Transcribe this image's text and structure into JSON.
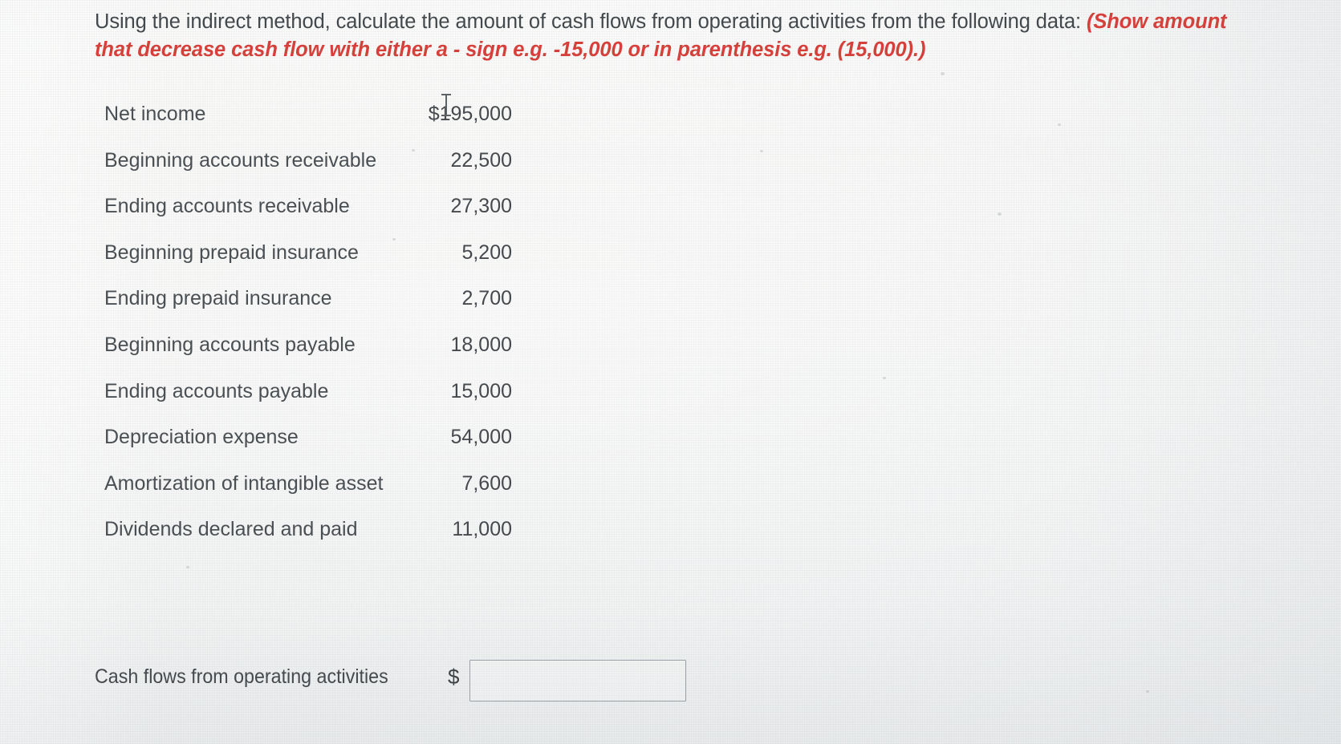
{
  "prompt": {
    "text_plain": "Using the indirect method, calculate the amount of cash flows from operating activities from the following data: ",
    "text_hint": "(Show amount that decrease cash flow with either a - sign e.g. -15,000 or in parenthesis e.g. (15,000).)",
    "hint_color": "#d6403a",
    "body_color": "#42484c"
  },
  "table": {
    "rows": [
      {
        "label": "Net income",
        "value": "$195,000"
      },
      {
        "label": "Beginning accounts receivable",
        "value": "22,500"
      },
      {
        "label": "Ending accounts receivable",
        "value": "27,300"
      },
      {
        "label": "Beginning prepaid insurance",
        "value": "5,200"
      },
      {
        "label": "Ending prepaid insurance",
        "value": "2,700"
      },
      {
        "label": "Beginning accounts payable",
        "value": "18,000"
      },
      {
        "label": "Ending accounts payable",
        "value": "15,000"
      },
      {
        "label": "Depreciation expense",
        "value": "54,000"
      },
      {
        "label": "Amortization of intangible asset",
        "value": "7,600"
      },
      {
        "label": "Dividends declared and paid",
        "value": "11,000"
      }
    ]
  },
  "answer": {
    "label": "Cash flows from operating activities",
    "currency_symbol": "$",
    "input_value": "",
    "input_placeholder": ""
  },
  "cursor": {
    "icon": "text-beam-cursor"
  }
}
